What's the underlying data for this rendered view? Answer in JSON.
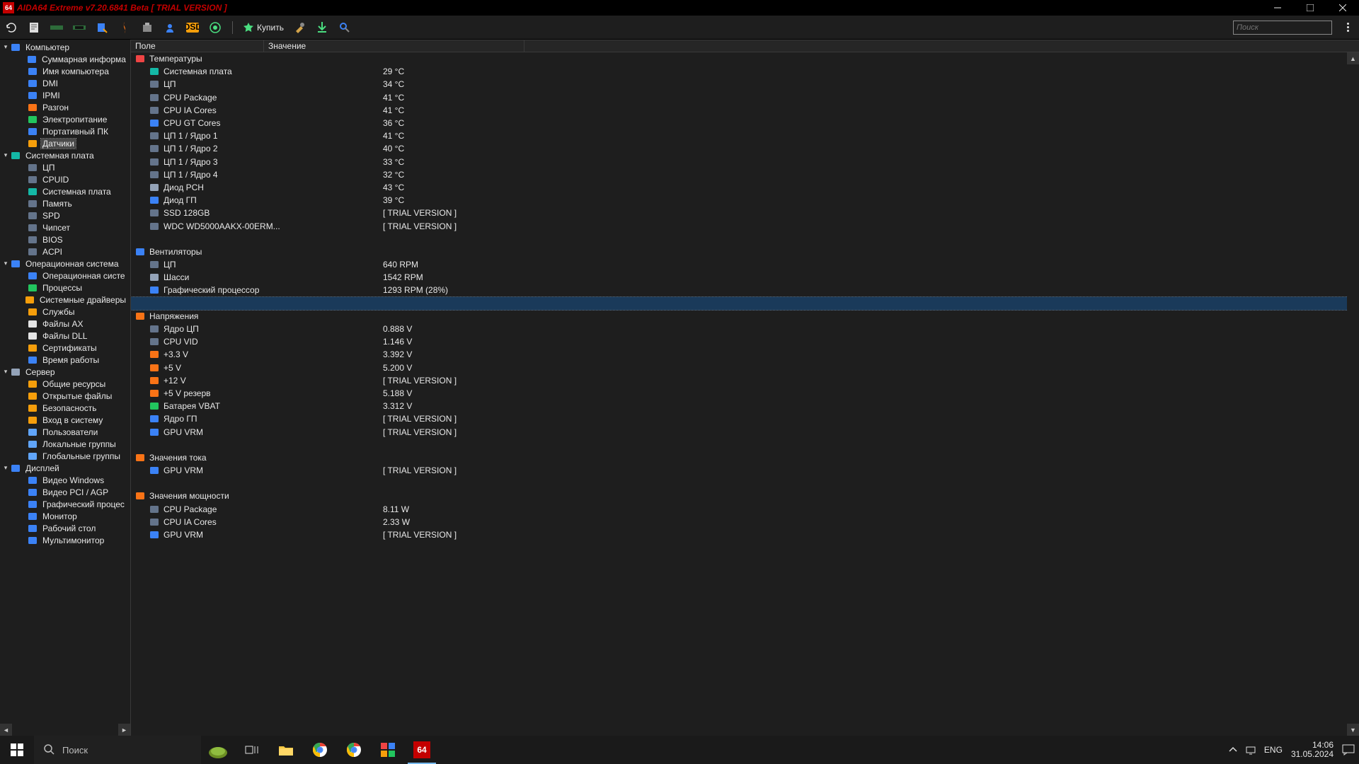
{
  "window": {
    "title": "AIDA64 Extreme v7.20.6841 Beta   [ TRIAL VERSION ]",
    "app_icon_text": "64"
  },
  "toolbar": {
    "buy_label": "Купить",
    "search_placeholder": "Поиск"
  },
  "columns": {
    "field": "Поле",
    "value": "Значение"
  },
  "tree": [
    {
      "lvl": 0,
      "exp": true,
      "icon": "computer",
      "label": "Компьютер"
    },
    {
      "lvl": 1,
      "icon": "monitor-b",
      "label": "Суммарная информа"
    },
    {
      "lvl": 1,
      "icon": "monitor-b",
      "label": "Имя компьютера"
    },
    {
      "lvl": 1,
      "icon": "monitor-b",
      "label": "DMI"
    },
    {
      "lvl": 1,
      "icon": "monitor-b",
      "label": "IPMI"
    },
    {
      "lvl": 1,
      "icon": "flame",
      "label": "Разгон"
    },
    {
      "lvl": 1,
      "icon": "plug",
      "label": "Электропитание"
    },
    {
      "lvl": 1,
      "icon": "monitor-b",
      "label": "Портативный ПК"
    },
    {
      "lvl": 1,
      "icon": "sensor",
      "label": "Датчики",
      "sel": true
    },
    {
      "lvl": 0,
      "exp": true,
      "icon": "board",
      "label": "Системная плата"
    },
    {
      "lvl": 1,
      "icon": "chip",
      "label": "ЦП"
    },
    {
      "lvl": 1,
      "icon": "chip",
      "label": "CPUID"
    },
    {
      "lvl": 1,
      "icon": "board-s",
      "label": "Системная плата"
    },
    {
      "lvl": 1,
      "icon": "ram",
      "label": "Память"
    },
    {
      "lvl": 1,
      "icon": "ram",
      "label": "SPD"
    },
    {
      "lvl": 1,
      "icon": "chip",
      "label": "Чипсет"
    },
    {
      "lvl": 1,
      "icon": "bios",
      "label": "BIOS"
    },
    {
      "lvl": 1,
      "icon": "chip",
      "label": "ACPI"
    },
    {
      "lvl": 0,
      "exp": true,
      "icon": "win",
      "label": "Операционная система"
    },
    {
      "lvl": 1,
      "icon": "win-s",
      "label": "Операционная систе"
    },
    {
      "lvl": 1,
      "icon": "proc",
      "label": "Процессы"
    },
    {
      "lvl": 1,
      "icon": "drv",
      "label": "Системные драйверы"
    },
    {
      "lvl": 1,
      "icon": "svc",
      "label": "Службы"
    },
    {
      "lvl": 1,
      "icon": "file",
      "label": "Файлы AX"
    },
    {
      "lvl": 1,
      "icon": "file",
      "label": "Файлы DLL"
    },
    {
      "lvl": 1,
      "icon": "cert",
      "label": "Сертификаты"
    },
    {
      "lvl": 1,
      "icon": "clock",
      "label": "Время работы"
    },
    {
      "lvl": 0,
      "exp": true,
      "icon": "server",
      "label": "Сервер"
    },
    {
      "lvl": 1,
      "icon": "folder",
      "label": "Общие ресурсы"
    },
    {
      "lvl": 1,
      "icon": "folder",
      "label": "Открытые файлы"
    },
    {
      "lvl": 1,
      "icon": "lock",
      "label": "Безопасность"
    },
    {
      "lvl": 1,
      "icon": "key",
      "label": "Вход в систему"
    },
    {
      "lvl": 1,
      "icon": "user",
      "label": "Пользователи"
    },
    {
      "lvl": 1,
      "icon": "users",
      "label": "Локальные группы"
    },
    {
      "lvl": 1,
      "icon": "users",
      "label": "Глобальные группы"
    },
    {
      "lvl": 0,
      "exp": true,
      "icon": "display",
      "label": "Дисплей"
    },
    {
      "lvl": 1,
      "icon": "video",
      "label": "Видео Windows"
    },
    {
      "lvl": 1,
      "icon": "video",
      "label": "Видео PCI / AGP"
    },
    {
      "lvl": 1,
      "icon": "gpu",
      "label": "Графический процес"
    },
    {
      "lvl": 1,
      "icon": "monitor-b",
      "label": "Монитор"
    },
    {
      "lvl": 1,
      "icon": "desktop",
      "label": "Рабочий стол"
    },
    {
      "lvl": 1,
      "icon": "multi",
      "label": "Мультимонитор"
    }
  ],
  "sensors": [
    {
      "type": "hdr",
      "icon": "temp",
      "label": "Температуры"
    },
    {
      "icon": "board-s",
      "label": "Системная плата",
      "val": "29 °C"
    },
    {
      "icon": "chip",
      "label": "ЦП",
      "val": "34 °C"
    },
    {
      "icon": "chip",
      "label": "CPU Package",
      "val": "41 °C"
    },
    {
      "icon": "chip",
      "label": "CPU IA Cores",
      "val": "41 °C"
    },
    {
      "icon": "gpu-b",
      "label": "CPU GT Cores",
      "val": "36 °C"
    },
    {
      "icon": "chip",
      "label": "ЦП 1 / Ядро 1",
      "val": "41 °C"
    },
    {
      "icon": "chip",
      "label": "ЦП 1 / Ядро 2",
      "val": "40 °C"
    },
    {
      "icon": "chip",
      "label": "ЦП 1 / Ядро 3",
      "val": "33 °C"
    },
    {
      "icon": "chip",
      "label": "ЦП 1 / Ядро 4",
      "val": "32 °C"
    },
    {
      "icon": "diode",
      "label": "Диод PCH",
      "val": "43 °C"
    },
    {
      "icon": "gpu-b",
      "label": "Диод ГП",
      "val": "39 °C"
    },
    {
      "icon": "ssd",
      "label": "SSD 128GB",
      "val": "[ TRIAL VERSION ]"
    },
    {
      "icon": "hdd",
      "label": "WDC WD5000AAKX-00ERM...",
      "val": "[ TRIAL VERSION ]"
    },
    {
      "type": "blank"
    },
    {
      "type": "hdr",
      "icon": "fan",
      "label": "Вентиляторы"
    },
    {
      "icon": "chip",
      "label": "ЦП",
      "val": "640 RPM"
    },
    {
      "icon": "chassis",
      "label": "Шасси",
      "val": "1542 RPM"
    },
    {
      "icon": "gpu-b",
      "label": "Графический процессор",
      "val": "1293 RPM  (28%)"
    },
    {
      "type": "selected-blank"
    },
    {
      "type": "hdr",
      "icon": "volt",
      "label": "Напряжения"
    },
    {
      "icon": "chip",
      "label": "Ядро ЦП",
      "val": "0.888 V"
    },
    {
      "icon": "chip",
      "label": "CPU VID",
      "val": "1.146 V"
    },
    {
      "icon": "volt",
      "label": "+3.3 V",
      "val": "3.392 V"
    },
    {
      "icon": "volt",
      "label": "+5 V",
      "val": "5.200 V"
    },
    {
      "icon": "volt",
      "label": "+12 V",
      "val": "[ TRIAL VERSION ]"
    },
    {
      "icon": "volt",
      "label": "+5 V резерв",
      "val": "5.188 V"
    },
    {
      "icon": "battery",
      "label": "Батарея VBAT",
      "val": "3.312 V"
    },
    {
      "icon": "gpu-b",
      "label": "Ядро ГП",
      "val": "[ TRIAL VERSION ]"
    },
    {
      "icon": "gpu-b",
      "label": "GPU VRM",
      "val": "[ TRIAL VERSION ]"
    },
    {
      "type": "blank"
    },
    {
      "type": "hdr",
      "icon": "volt",
      "label": "Значения тока"
    },
    {
      "icon": "gpu-b",
      "label": "GPU VRM",
      "val": "[ TRIAL VERSION ]"
    },
    {
      "type": "blank"
    },
    {
      "type": "hdr",
      "icon": "volt",
      "label": "Значения мощности"
    },
    {
      "icon": "chip",
      "label": "CPU Package",
      "val": "8.11 W"
    },
    {
      "icon": "chip",
      "label": "CPU IA Cores",
      "val": "2.33 W"
    },
    {
      "icon": "gpu-b",
      "label": "GPU VRM",
      "val": "[ TRIAL VERSION ]"
    }
  ],
  "taskbar": {
    "search_label": "Поиск",
    "lang": "ENG",
    "time": "14:06",
    "date": "31.05.2024"
  },
  "icons": {
    "computer": "#3b82f6",
    "monitor-b": "#3b82f6",
    "flame": "#f97316",
    "plug": "#22c55e",
    "sensor": "#f59e0b",
    "board": "#14b8a6",
    "chip": "#64748b",
    "board-s": "#14b8a6",
    "ram": "#64748b",
    "bios": "#64748b",
    "win": "#3b82f6",
    "win-s": "#3b82f6",
    "proc": "#22c55e",
    "drv": "#f59e0b",
    "svc": "#f59e0b",
    "file": "#e5e5e5",
    "cert": "#f59e0b",
    "clock": "#3b82f6",
    "server": "#94a3b8",
    "folder": "#f59e0b",
    "lock": "#f59e0b",
    "key": "#f59e0b",
    "user": "#60a5fa",
    "users": "#60a5fa",
    "display": "#3b82f6",
    "video": "#3b82f6",
    "gpu": "#3b82f6",
    "desktop": "#3b82f6",
    "multi": "#3b82f6",
    "temp": "#ef4444",
    "fan": "#3b82f6",
    "volt": "#f97316",
    "gpu-b": "#3b82f6",
    "diode": "#94a3b8",
    "ssd": "#64748b",
    "hdd": "#64748b",
    "chassis": "#94a3b8",
    "battery": "#22c55e"
  }
}
